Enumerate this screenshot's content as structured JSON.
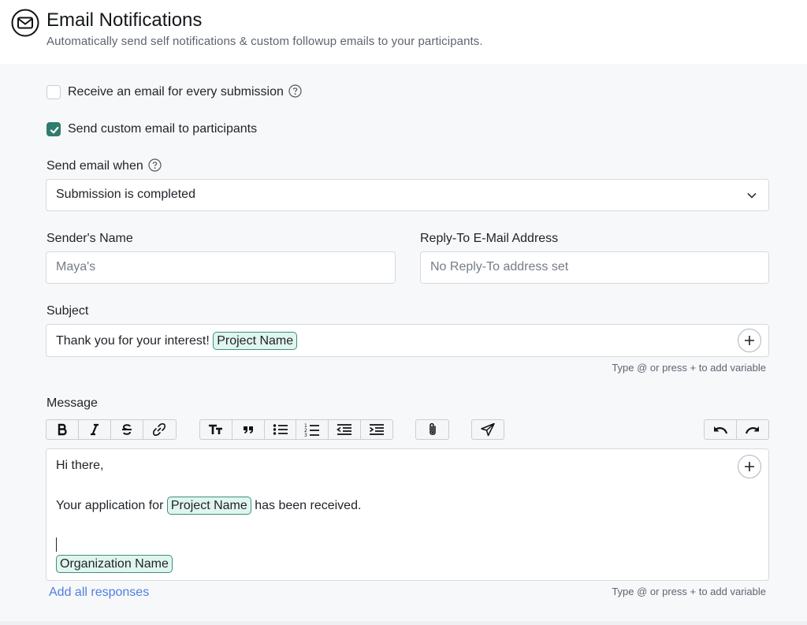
{
  "header": {
    "title": "Email Notifications",
    "subtitle": "Automatically send self notifications & custom followup emails to your participants.",
    "icon": "envelope-icon"
  },
  "options": {
    "receive_every": {
      "label": "Receive an email for every submission",
      "checked": false
    },
    "send_custom": {
      "label": "Send custom email to participants",
      "checked": true
    }
  },
  "send_when": {
    "label": "Send email when",
    "selected": "Submission is completed"
  },
  "sender": {
    "label": "Sender's Name",
    "placeholder": "Maya's"
  },
  "reply_to": {
    "label": "Reply-To E-Mail Address",
    "placeholder": "No Reply-To address set"
  },
  "subject": {
    "label": "Subject",
    "text": "Thank you for your interest!",
    "variable": "Project Name",
    "hint": "Type @ or press + to add variable"
  },
  "message": {
    "label": "Message",
    "line1": "Hi there,",
    "line2_prefix": "Your application for",
    "line2_variable": "Project Name",
    "line2_suffix": "has been received.",
    "signature_variable": "Organization Name",
    "hint": "Type @ or press + to add variable",
    "add_all": "Add all responses"
  },
  "toolbar": {
    "groups": [
      [
        "bold-icon",
        "italic-icon",
        "strikethrough-icon",
        "link-icon"
      ],
      [
        "text-size-icon",
        "quote-icon",
        "bullet-list-icon",
        "numbered-list-icon",
        "outdent-icon",
        "indent-icon"
      ],
      [
        "attachment-icon"
      ],
      [
        "send-icon"
      ],
      [
        "undo-icon",
        "redo-icon"
      ]
    ]
  },
  "colors": {
    "accent": "#2f7d6f",
    "chip_bg": "#dff5ee",
    "chip_border": "#3f8f7a",
    "link": "#4f7fe0"
  }
}
